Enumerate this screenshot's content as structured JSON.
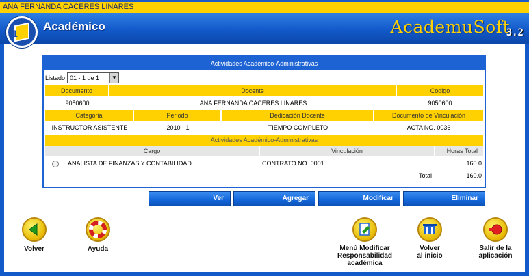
{
  "user_bar": {
    "name": "ANA FERNANDA CACERES LINARES"
  },
  "header": {
    "title": "Académico",
    "brand": "AcademuSoft",
    "version": "3.2"
  },
  "panel": {
    "title": "Actividades Académico-Administrativas",
    "listado_label": "Listado",
    "listado_value": "01 - 1 de 1",
    "doc_headers": {
      "documento": "Documento",
      "docente": "Docente",
      "codigo": "Código"
    },
    "doc_values": {
      "documento": "9050600",
      "docente": "ANA FERNANDA CACERES LINARES",
      "codigo": "9050600"
    },
    "cat_headers": {
      "categoria": "Categoria",
      "periodo": "Periodo",
      "dedicacion": "Dedicación Docente",
      "vinculacion": "Documento de Vinculación"
    },
    "cat_values": {
      "categoria": "INSTRUCTOR ASISTENTE",
      "periodo": "2010 - 1",
      "dedicacion": "TIEMPO COMPLETO",
      "vinculacion": "ACTA NO. 0036"
    },
    "activities_title": "Actividades Académico-Administrativas",
    "act_headers": {
      "cargo": "Cargo",
      "vinculacion": "Vinculación",
      "horas": "Horas Total"
    },
    "activities": [
      {
        "cargo": "ANALISTA DE FINANZAS Y CONTABILIDAD",
        "vinculacion": "CONTRATO NO. 0001",
        "horas": "160.0"
      }
    ],
    "total_label": "Total",
    "total_value": "160.0"
  },
  "actions": {
    "ver": "Ver",
    "agregar": "Agregar",
    "modificar": "Modificar",
    "eliminar": "Eliminar"
  },
  "nav": {
    "volver": "Volver",
    "ayuda": "Ayuda",
    "menu_line1": "Menú Modificar",
    "menu_line2": "Responsabilidad",
    "menu_line3": "académica",
    "inicio_line1": "Volver",
    "inicio_line2": "al inicio",
    "salir_line1": "Salir de la",
    "salir_line2": "aplicación"
  },
  "icons": {
    "volver": "left-arrow-icon",
    "ayuda": "lifebuoy-icon",
    "menu": "edit-document-icon",
    "inicio": "home-icon",
    "salir": "exit-door-icon"
  },
  "colors": {
    "primary_blue": "#1e63d4",
    "accent_yellow": "#ffd100",
    "header_blue": "#1259c9"
  }
}
